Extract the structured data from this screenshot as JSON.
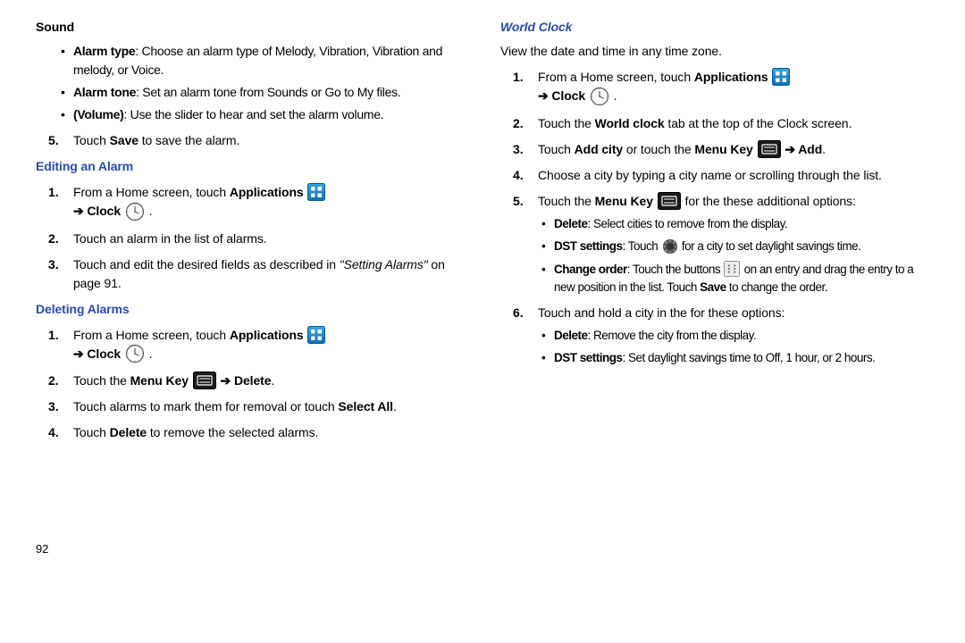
{
  "left": {
    "sound_heading": "Sound",
    "sound_bullets": {
      "b1_label": "Alarm type",
      "b1_text": ": Choose an alarm type of Melody, Vibration, Vibration and melody, or Voice.",
      "b2_label": "Alarm tone",
      "b2_text": ": Set an alarm tone from Sounds or Go to My files.",
      "b3_label": "(Volume)",
      "b3_text": ": Use the slider to hear and set the alarm volume."
    },
    "step5_a": "Touch ",
    "step5_b": "Save",
    "step5_c": " to save the alarm.",
    "editing_heading": "Editing an Alarm",
    "editing": {
      "s1_a": "From a Home screen, touch ",
      "s1_b": "Applications",
      "s1_arrow": "➔ ",
      "s1_clock": "Clock",
      "s1_end": " .",
      "s2": "Touch an alarm in the list of alarms.",
      "s3_a": "Touch and edit the desired fields as described in ",
      "s3_b": "\"Setting Alarms\"",
      "s3_c": " on page 91."
    },
    "deleting_heading": "Deleting Alarms",
    "deleting": {
      "s1_a": "From a Home screen, touch ",
      "s1_b": "Applications",
      "s1_arrow": "➔ ",
      "s1_clock": "Clock",
      "s1_end": " .",
      "s2_a": "Touch the ",
      "s2_b": "Menu Key",
      "s2_arrow": " ➔ ",
      "s2_c": "Delete",
      "s2_d": ".",
      "s3_a": "Touch alarms to mark them for removal or touch ",
      "s3_b": "Select All",
      "s3_c": ".",
      "s4_a": "Touch ",
      "s4_b": "Delete",
      "s4_c": " to remove the selected alarms."
    }
  },
  "right": {
    "world_heading": "World Clock",
    "intro": "View the date and time in any time zone.",
    "s1_a": "From a Home screen, touch ",
    "s1_b": "Applications",
    "s1_arrow": "➔ ",
    "s1_clock": "Clock",
    "s1_end": " .",
    "s2_a": "Touch the ",
    "s2_b": "World clock",
    "s2_c": " tab at the top of the Clock screen.",
    "s3_a": "Touch ",
    "s3_b": "Add city",
    "s3_c": " or touch the ",
    "s3_d": "Menu Key",
    "s3_arrow": " ➔ ",
    "s3_e": "Add",
    "s3_f": ".",
    "s4": "Choose a city by typing a city name or scrolling through the list.",
    "s5_a": "Touch the ",
    "s5_b": "Menu Key",
    "s5_c": " for the these additional options:",
    "s5_bullets": {
      "b1_label": "Delete",
      "b1_text": ": Select cities to remove from the display.",
      "b2_label": "DST settings",
      "b2_text_a": ": Touch ",
      "b2_text_b": " for a city to set daylight savings time.",
      "b3_label": "Change order",
      "b3_text_a": ": Touch the buttons ",
      "b3_text_b": " on an entry and drag the entry to a new position in the list. Touch ",
      "b3_save": "Save",
      "b3_text_c": " to change the order."
    },
    "s6": "Touch and hold a city in the for these options:",
    "s6_bullets": {
      "b1_label": "Delete",
      "b1_text": ": Remove the city from the display.",
      "b2_label": "DST settings",
      "b2_text": ": Set daylight savings time to Off, 1 hour, or 2 hours."
    }
  },
  "page_number": "92"
}
